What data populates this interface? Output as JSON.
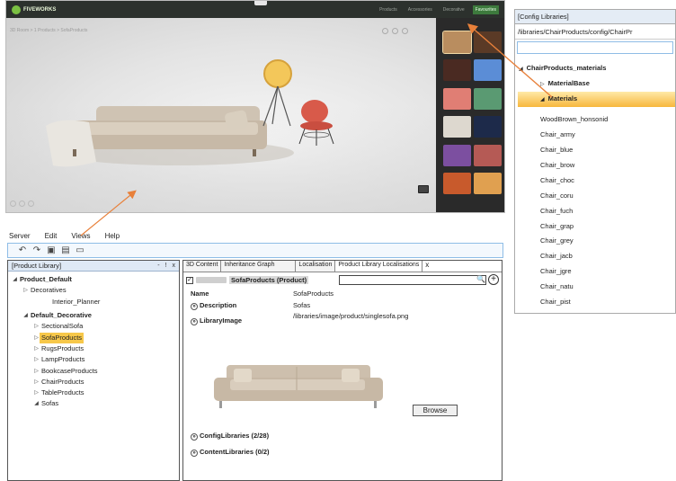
{
  "viewer": {
    "logo_text": "FIVEWORKS",
    "breadcrumb": "3D Room > 1 Products > SofaProducts",
    "tabs": [
      "Products",
      "Accessories",
      "Decorative",
      "Favourites"
    ],
    "active_tab_label": "Favourites",
    "swatches": [
      "#b98d5f",
      "#5a3a26",
      "#4a2a22",
      "#5b8dd6",
      "#e07e74",
      "#5a9a72",
      "#ddd8cf",
      "#1d2a4a",
      "#7c4fa0",
      "#b55a55",
      "#c85a2c",
      "#e0a050"
    ]
  },
  "menu": {
    "items": [
      "Server",
      "Edit",
      "Views",
      "Help"
    ]
  },
  "toolbar": {
    "icons": [
      "undo-icon",
      "redo-icon",
      "save-icon",
      "edit-icon",
      "folder-icon"
    ]
  },
  "library_panel": {
    "title": "[Product Library]",
    "controls": [
      "-",
      "!",
      "x"
    ],
    "tree": [
      {
        "label": "Product_Default",
        "indent": 0,
        "arrow": "◢",
        "bold": true
      },
      {
        "label": "Decoratives",
        "indent": 1,
        "arrow": "▷",
        "bold": false
      },
      {
        "label": "Interior_Planner",
        "indent": 3,
        "arrow": "",
        "bold": false
      },
      {
        "label": "Default_Decorative",
        "indent": 1,
        "arrow": "◢",
        "bold": true
      },
      {
        "label": "SectionalSofa",
        "indent": 2,
        "arrow": "▷",
        "bold": false
      },
      {
        "label": "SofaProducts",
        "indent": 2,
        "arrow": "▷",
        "bold": false,
        "selected": true
      },
      {
        "label": "RugsProducts",
        "indent": 2,
        "arrow": "▷",
        "bold": false
      },
      {
        "label": "LampProducts",
        "indent": 2,
        "arrow": "▷",
        "bold": false
      },
      {
        "label": "BookcaseProducts",
        "indent": 2,
        "arrow": "▷",
        "bold": false
      },
      {
        "label": "ChairProducts",
        "indent": 2,
        "arrow": "▷",
        "bold": false
      },
      {
        "label": "TableProducts",
        "indent": 2,
        "arrow": "▷",
        "bold": false
      },
      {
        "label": "Sofas",
        "indent": 2,
        "arrow": "◢",
        "bold": false
      }
    ]
  },
  "detail_panel": {
    "tabs": [
      "3D Content",
      "Inheritance Graph",
      "Localisation",
      "Product Library Localisations"
    ],
    "close": "x",
    "product_title": "SofaProducts (Product)",
    "search_placeholder": "",
    "name_label": "Name",
    "name_value": "SofaProducts",
    "description_label": "Description",
    "description_value": "Sofas",
    "image_label": "LibraryImage",
    "image_value": "/libraries/image/product/singlesofa.png",
    "browse_label": "Browse",
    "config_libs_label": "ConfigLibraries (2/28)",
    "content_libs_label": "ContentLibraries (0/2)"
  },
  "config_panel": {
    "title": "[Config Libraries]",
    "path": "/libraries/ChairProducts/config/ChairPr",
    "tree": [
      {
        "label": "ChairProducts_materials",
        "arrow": "◢",
        "bold": true,
        "level": 0
      },
      {
        "label": "MaterialBase",
        "arrow": "▷",
        "bold": true,
        "level": 1
      },
      {
        "label": "Materials",
        "arrow": "◢",
        "bold": true,
        "level": 1,
        "selected": true
      },
      {
        "label": "WoodBrown_honsonid",
        "arrow": "",
        "bold": false,
        "level": 2
      },
      {
        "label": "Chair_army",
        "arrow": "",
        "bold": false,
        "level": 2
      },
      {
        "label": "Chair_blue",
        "arrow": "",
        "bold": false,
        "level": 2
      },
      {
        "label": "Chair_brow",
        "arrow": "",
        "bold": false,
        "level": 2
      },
      {
        "label": "Chair_choc",
        "arrow": "",
        "bold": false,
        "level": 2
      },
      {
        "label": "Chair_coru",
        "arrow": "",
        "bold": false,
        "level": 2
      },
      {
        "label": "Chair_fuch",
        "arrow": "",
        "bold": false,
        "level": 2
      },
      {
        "label": "Chair_grap",
        "arrow": "",
        "bold": false,
        "level": 2
      },
      {
        "label": "Chair_grey",
        "arrow": "",
        "bold": false,
        "level": 2
      },
      {
        "label": "Chair_jacb",
        "arrow": "",
        "bold": false,
        "level": 2
      },
      {
        "label": "Chair_jgre",
        "arrow": "",
        "bold": false,
        "level": 2
      },
      {
        "label": "Chair_natu",
        "arrow": "",
        "bold": false,
        "level": 2
      },
      {
        "label": "Chair_pist",
        "arrow": "",
        "bold": false,
        "level": 2
      }
    ]
  },
  "annotation_color": "#e8803a"
}
